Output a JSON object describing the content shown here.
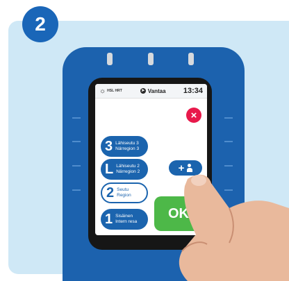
{
  "step": {
    "number": "2"
  },
  "status_bar": {
    "operator": "HSL HRT",
    "location": "Vantaa",
    "time": "13:34"
  },
  "zones": [
    {
      "big": "3",
      "line1": "Lähiseutu 3",
      "line2": "Närregion 3"
    },
    {
      "big": "L",
      "line1": "Lähiseutu 2",
      "line2": "Närregion 2"
    },
    {
      "big": "2",
      "line1": "Seutu",
      "line2": "Region"
    },
    {
      "big": "1",
      "line1": "Sisäinen",
      "line2": "Intern resa"
    }
  ],
  "buttons": {
    "add": "+",
    "ok": "OK",
    "close": "×"
  },
  "colors": {
    "device_blue": "#1c62ae",
    "ok_green": "#4db848",
    "close_red": "#e8194b",
    "panel_bg": "#cfe8f6"
  },
  "icons": [
    "sun-icon",
    "location-arrow-icon",
    "close-icon",
    "person-icon"
  ]
}
